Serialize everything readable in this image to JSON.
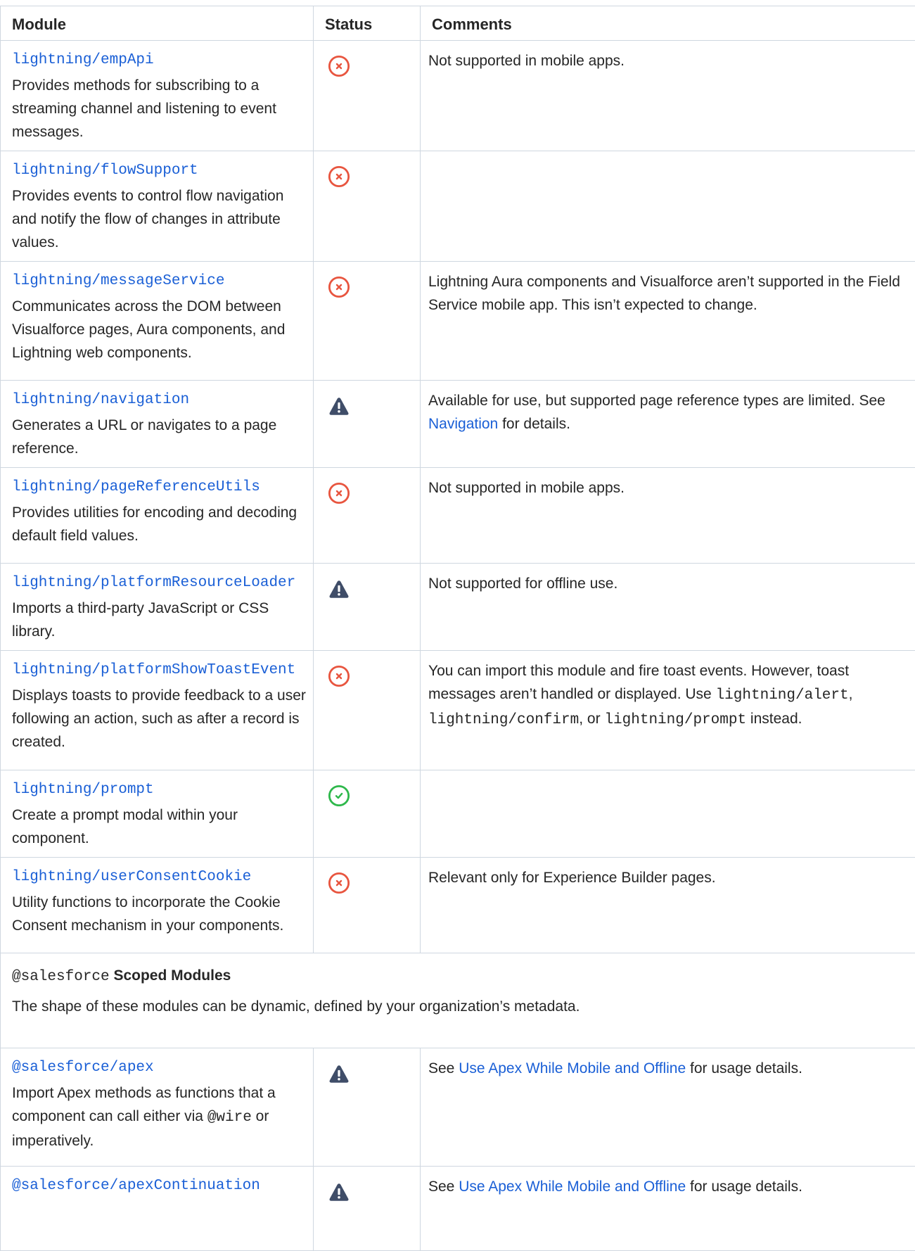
{
  "colors": {
    "link": "#1a5fd6",
    "unsupported": "#e8553f",
    "warning": "#3f4d68",
    "supported": "#2eb84b",
    "border": "#cfd7e0"
  },
  "headers": {
    "module": "Module",
    "status": "Status",
    "comments": "Comments"
  },
  "rows": [
    {
      "module": "lightning/empApi",
      "desc": "Provides methods for subscribing to a streaming channel and listening to event messages.",
      "status": "unsupported-icon",
      "comment": "Not supported in mobile apps."
    },
    {
      "module": "lightning/flowSupport",
      "desc": "Provides events to control flow navigation and notify the flow of changes in attribute values.",
      "status": "unsupported-icon",
      "comment": ""
    },
    {
      "module": "lightning/messageService",
      "desc": "Communicates across the DOM between Visualforce pages, Aura components, and Lightning web components.",
      "status": "unsupported-icon",
      "comment": "Lightning Aura components and Visualforce aren’t supported in the Field Service mobile app. This isn’t expected to change."
    },
    {
      "module": "lightning/navigation",
      "desc": "Generates a URL or navigates to a page reference.",
      "status": "warning-icon",
      "comment_pre": "Available for use, but supported page reference types are limited. See ",
      "comment_link": "Navigation",
      "comment_post": " for details."
    },
    {
      "module": "lightning/pageReferenceUtils",
      "desc": "Provides utilities for encoding and decoding default field values.",
      "status": "unsupported-icon",
      "comment": "Not supported in mobile apps."
    },
    {
      "module": "lightning/platformResourceLoader",
      "desc": "Imports a third-party JavaScript or CSS library.",
      "status": "warning-icon",
      "comment": "Not supported for offline use."
    },
    {
      "module": "lightning/platformShowToastEvent",
      "desc": "Displays toasts to provide feedback to a user following an action, such as after a record is created.",
      "status": "unsupported-icon",
      "comment_pre": "You can import this module and fire toast events. However, toast messages aren’t handled or displayed. Use ",
      "code1": "lightning/alert",
      "sep1": ", ",
      "code2": "lightning/confirm",
      "sep2": ", or ",
      "code3": "lightning/prompt",
      "comment_post": " instead."
    },
    {
      "module": "lightning/prompt",
      "desc": "Create a prompt modal within your component.",
      "status": "supported-icon",
      "comment": ""
    },
    {
      "module": "lightning/userConsentCookie",
      "desc": "Utility functions to incorporate the Cookie Consent mechanism in your components.",
      "status": "unsupported-icon",
      "comment": "Relevant only for Experience Builder pages."
    }
  ],
  "section": {
    "code": "@salesforce",
    "title": " Scoped Modules",
    "desc": "The shape of these modules can be dynamic, defined by your organization’s metadata."
  },
  "scoped_rows": [
    {
      "module": "@salesforce/apex",
      "desc_pre": "Import Apex methods as functions that a component can call either via ",
      "desc_code": "@wire",
      "desc_post": " or imperatively.",
      "status": "warning-icon",
      "comment_pre": "See ",
      "comment_link": "Use Apex While Mobile and Offline",
      "comment_post": " for usage details."
    },
    {
      "module": "@salesforce/apexContinuation",
      "status": "warning-icon",
      "comment_pre": "See ",
      "comment_link": "Use Apex While Mobile and Offline",
      "comment_post": " for usage details."
    }
  ]
}
